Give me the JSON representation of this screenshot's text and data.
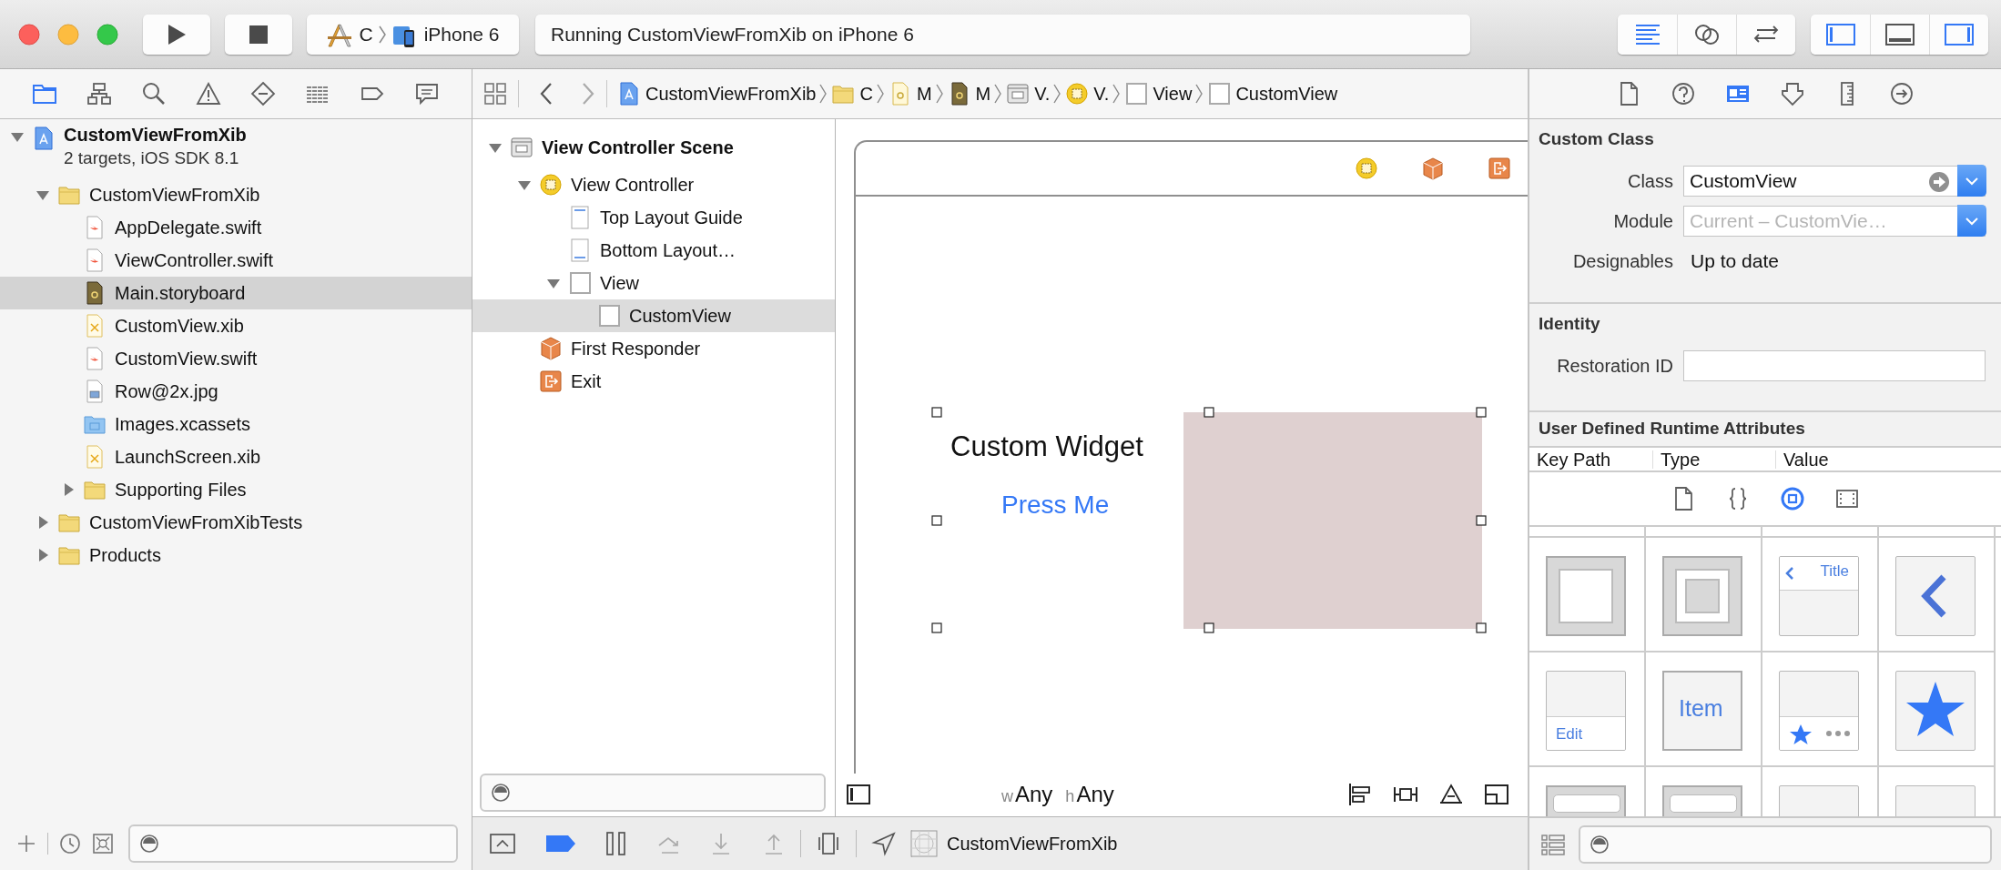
{
  "toolbar": {
    "scheme": {
      "target": "C",
      "device": "iPhone 6"
    },
    "activity": "Running CustomViewFromXib on iPhone 6",
    "editor_modes": [
      {
        "kind": "standard",
        "selected": true
      },
      {
        "kind": "assistant",
        "selected": false
      },
      {
        "kind": "version",
        "selected": false
      }
    ],
    "panels": [
      {
        "kind": "navigator",
        "on": true
      },
      {
        "kind": "debug",
        "on": false
      },
      {
        "kind": "utilities",
        "on": true
      }
    ]
  },
  "navigator": {
    "tabs": [
      {
        "kind": "project",
        "selected": true
      },
      {
        "kind": "symbol",
        "selected": false
      },
      {
        "kind": "find",
        "selected": false
      },
      {
        "kind": "issue",
        "selected": false
      },
      {
        "kind": "test",
        "selected": false
      },
      {
        "kind": "debug",
        "selected": false
      },
      {
        "kind": "breakpoint",
        "selected": false
      },
      {
        "kind": "report",
        "selected": false
      }
    ],
    "tree": [
      {
        "label": "CustomViewFromXib",
        "subtitle": "2 targets, iOS SDK 8.1",
        "kind": "project",
        "expanded": true,
        "selected": false,
        "children": [
          {
            "label": "CustomViewFromXib",
            "kind": "folder",
            "expanded": true,
            "selected": false,
            "children": [
              {
                "label": "AppDelegate.swift",
                "kind": "swift",
                "selected": false
              },
              {
                "label": "ViewController.swift",
                "kind": "swift",
                "selected": false
              },
              {
                "label": "Main.storyboard",
                "kind": "storyboard",
                "selected": true
              },
              {
                "label": "CustomView.xib",
                "kind": "xib",
                "selected": false
              },
              {
                "label": "CustomView.swift",
                "kind": "swift",
                "selected": false
              },
              {
                "label": "Row@2x.jpg",
                "kind": "image",
                "selected": false
              },
              {
                "label": "Images.xcassets",
                "kind": "assets",
                "selected": false
              },
              {
                "label": "LaunchScreen.xib",
                "kind": "xib",
                "selected": false
              },
              {
                "label": "Supporting Files",
                "kind": "folder",
                "expanded": false,
                "selected": false
              }
            ]
          },
          {
            "label": "CustomViewFromXibTests",
            "kind": "folder",
            "expanded": false,
            "selected": false
          },
          {
            "label": "Products",
            "kind": "folder",
            "expanded": false,
            "selected": false
          }
        ]
      }
    ]
  },
  "jump_bar": {
    "items": [
      {
        "kind": "project",
        "label": "CustomViewFromXib"
      },
      {
        "kind": "folder",
        "label": "C"
      },
      {
        "kind": "storyboard-source",
        "label": "M"
      },
      {
        "kind": "storyboard",
        "label": "M"
      },
      {
        "kind": "scene",
        "label": "V."
      },
      {
        "kind": "controller",
        "label": "V."
      },
      {
        "kind": "view",
        "label": "View"
      },
      {
        "kind": "view",
        "label": "CustomView"
      }
    ]
  },
  "outline": {
    "tree": [
      {
        "label": "View Controller Scene",
        "kind": "scene",
        "expanded": true,
        "selected": false,
        "children": [
          {
            "label": "View Controller",
            "kind": "controller",
            "expanded": true,
            "selected": false,
            "children": [
              {
                "label": "Top Layout Guide",
                "kind": "top-guide",
                "selected": false
              },
              {
                "label": "Bottom Layout…",
                "kind": "bottom-guide",
                "selected": false
              },
              {
                "label": "View",
                "kind": "view",
                "expanded": true,
                "selected": false,
                "children": [
                  {
                    "label": "CustomView",
                    "kind": "view",
                    "selected": true
                  }
                ]
              }
            ]
          },
          {
            "label": "First Responder",
            "kind": "responder",
            "selected": false
          },
          {
            "label": "Exit",
            "kind": "exit",
            "selected": false
          }
        ]
      }
    ]
  },
  "canvas": {
    "scene_dock": [
      {
        "kind": "controller"
      },
      {
        "kind": "responder"
      },
      {
        "kind": "exit"
      }
    ],
    "custom_view": {
      "selected": true,
      "label": "Custom Widget",
      "button": "Press Me"
    },
    "size_class": {
      "width_prefix": "w",
      "width": "Any",
      "height_prefix": "h",
      "height": "Any"
    }
  },
  "debug_bar": {
    "breakpoints_active": true,
    "target": "CustomViewFromXib"
  },
  "inspector": {
    "tabs": [
      {
        "kind": "file",
        "selected": false
      },
      {
        "kind": "help",
        "selected": false
      },
      {
        "kind": "identity",
        "selected": true
      },
      {
        "kind": "attributes",
        "selected": false
      },
      {
        "kind": "size",
        "selected": false
      },
      {
        "kind": "connections",
        "selected": false
      }
    ],
    "sections": [
      {
        "title": "Custom Class",
        "rows": [
          {
            "label": "Class",
            "kind": "class-combo",
            "value": "CustomView"
          },
          {
            "label": "Module",
            "kind": "combo",
            "placeholder": "Current – CustomVie…"
          },
          {
            "label": "Designables",
            "kind": "text",
            "value": "Up to date"
          }
        ]
      },
      {
        "title": "Identity",
        "rows": [
          {
            "label": "Restoration ID",
            "kind": "field"
          }
        ]
      }
    ],
    "runtime_attributes": {
      "title": "User Defined Runtime Attributes",
      "columns": [
        "Key Path",
        "Type",
        "Value"
      ]
    },
    "library": {
      "tabs": [
        {
          "kind": "file",
          "selected": false
        },
        {
          "kind": "code",
          "selected": false
        },
        {
          "kind": "object",
          "selected": true
        },
        {
          "kind": "media",
          "selected": false
        }
      ],
      "items": [
        {
          "kind": "view"
        },
        {
          "kind": "container"
        },
        {
          "kind": "navigation-bar",
          "text": "Title"
        },
        {
          "kind": "back"
        },
        {
          "kind": "toolbar",
          "text": "Edit"
        },
        {
          "kind": "bar-item",
          "text": "Item"
        },
        {
          "kind": "tab-bar"
        },
        {
          "kind": "tab-item"
        },
        {
          "kind": "search-bar"
        },
        {
          "kind": "search-bar"
        },
        {
          "kind": "object"
        },
        {
          "kind": "object"
        }
      ]
    }
  }
}
